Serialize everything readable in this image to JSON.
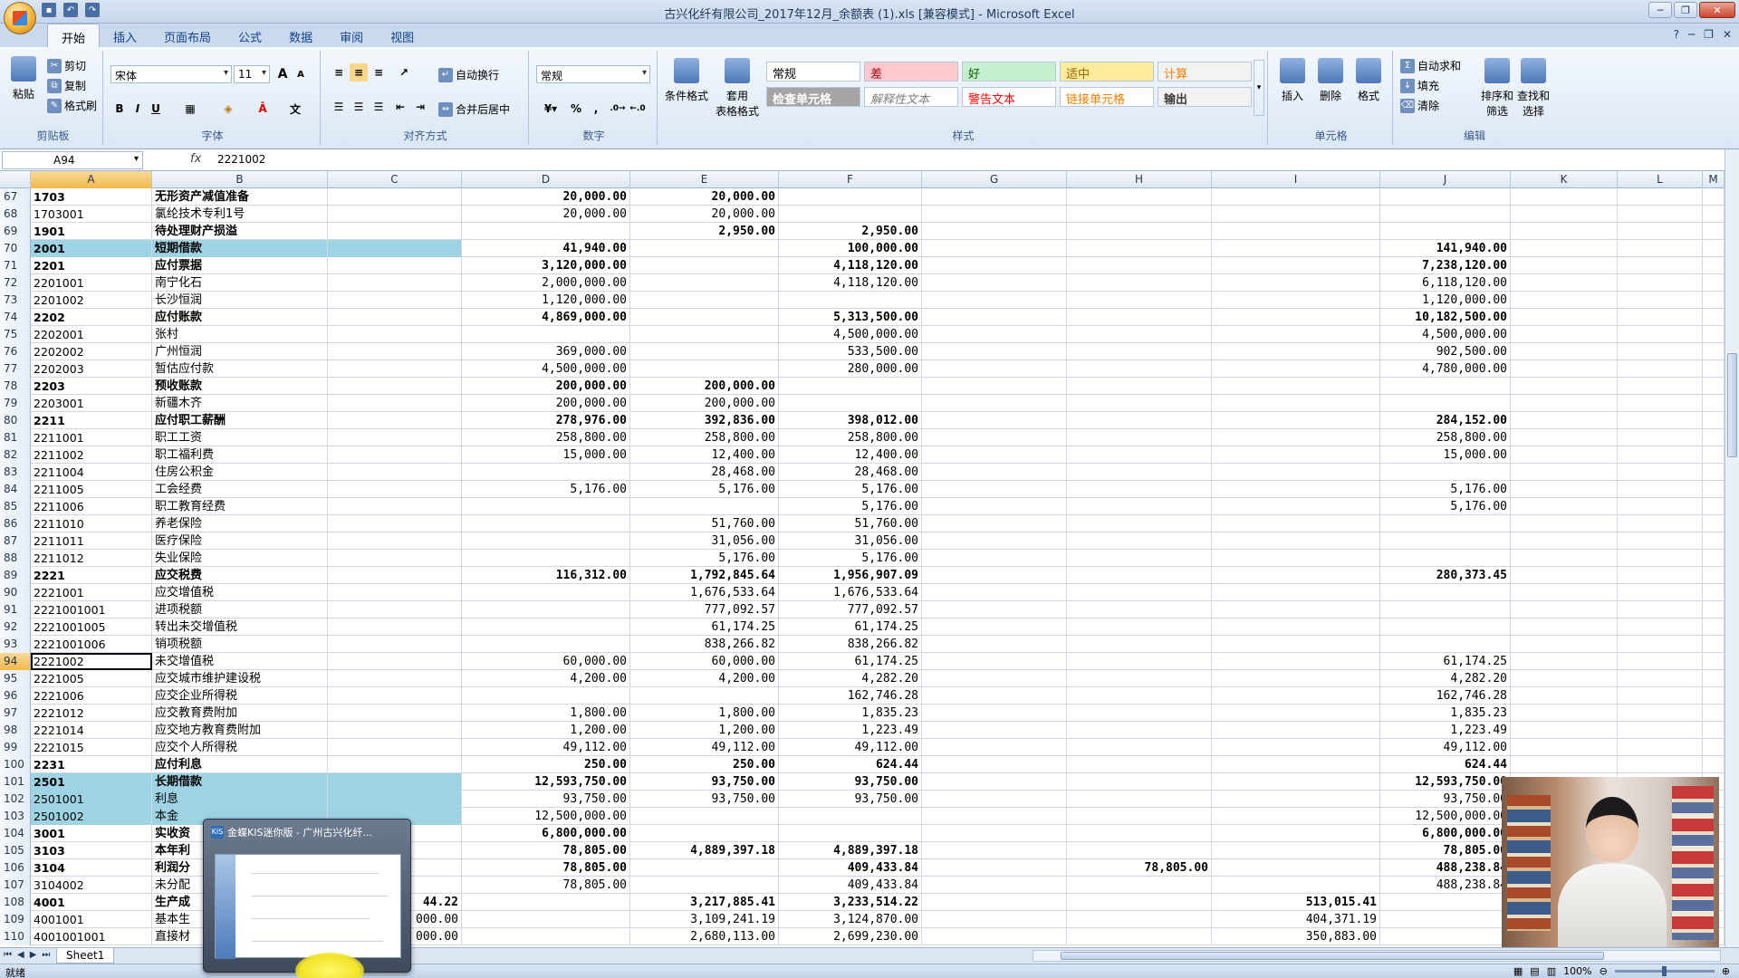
{
  "window": {
    "title": "古兴化纤有限公司_2017年12月_余额表 (1).xls  [兼容模式] - Microsoft Excel",
    "controls": [
      "─",
      "❐",
      "✕"
    ],
    "app_controls": [
      "?",
      "─",
      "❐",
      "✕"
    ]
  },
  "tabs": [
    "开始",
    "插入",
    "页面布局",
    "公式",
    "数据",
    "审阅",
    "视图"
  ],
  "ribbon": {
    "clipboard": {
      "paste": "粘贴",
      "cut": "剪切",
      "copy": "复制",
      "format_painter": "格式刷",
      "label": "剪贴板"
    },
    "font": {
      "name": "宋体",
      "size": "11",
      "bold": "B",
      "italic": "I",
      "underline": "U",
      "grow": "A",
      "shrink": "A",
      "label": "字体"
    },
    "alignment": {
      "wrap": "自动换行",
      "merge": "合并后居中",
      "label": "对齐方式"
    },
    "number": {
      "format": "常规",
      "percent": "%",
      "comma": ",",
      "label": "数字"
    },
    "styles": {
      "conditional": "条件格式",
      "table_format": "套用\n表格格式",
      "cells": [
        {
          "text": "常规",
          "bg": "#ffffff",
          "color": "#000000"
        },
        {
          "text": "差",
          "bg": "#ffc7ce",
          "color": "#9c0006"
        },
        {
          "text": "好",
          "bg": "#c6efce",
          "color": "#006100"
        },
        {
          "text": "适中",
          "bg": "#ffeb9c",
          "color": "#9c6500"
        },
        {
          "text": "计算",
          "bg": "#f2f2f2",
          "color": "#fa7d00"
        },
        {
          "text": "检查单元格",
          "bg": "#a5a5a5",
          "color": "#ffffff"
        },
        {
          "text": "解释性文本",
          "bg": "#ffffff",
          "color": "#7f7f7f"
        },
        {
          "text": "警告文本",
          "bg": "#ffffff",
          "color": "#ff0000"
        },
        {
          "text": "链接单元格",
          "bg": "#ffffff",
          "color": "#fa7d00"
        },
        {
          "text": "输出",
          "bg": "#f2f2f2",
          "color": "#3f3f3f"
        }
      ],
      "label": "样式"
    },
    "cells_group": {
      "insert": "插入",
      "delete": "删除",
      "format": "格式",
      "label": "单元格"
    },
    "editing": {
      "autosum": "自动求和",
      "fill": "填充",
      "clear": "清除",
      "sort": "排序和\n筛选",
      "find": "查找和\n选择",
      "label": "编辑"
    }
  },
  "formula_bar": {
    "name_box": "A94",
    "fx": "fx",
    "value": "2221002"
  },
  "columns": [
    "A",
    "B",
    "C",
    "D",
    "E",
    "F",
    "G",
    "H",
    "I",
    "J",
    "K",
    "L",
    "M"
  ],
  "rows": [
    {
      "n": "67",
      "a": "1703",
      "b": "无形资产减值准备",
      "c": "",
      "d": "20,000.00",
      "e": "20,000.00",
      "f": "",
      "g": "",
      "h": "",
      "i": "",
      "j": "",
      "bold": true
    },
    {
      "n": "68",
      "a": "1703001",
      "b": "氯纶技术专利1号",
      "c": "",
      "d": "20,000.00",
      "e": "20,000.00",
      "f": "",
      "g": "",
      "h": "",
      "i": "",
      "j": ""
    },
    {
      "n": "69",
      "a": "1901",
      "b": "待处理财产损溢",
      "c": "",
      "d": "",
      "e": "2,950.00",
      "f": "2,950.00",
      "g": "",
      "h": "",
      "i": "",
      "j": "",
      "bold": true
    },
    {
      "n": "70",
      "a": "2001",
      "b": "短期借款",
      "c": "",
      "d": "41,940.00",
      "e": "",
      "f": "100,000.00",
      "g": "",
      "h": "",
      "i": "",
      "j": "141,940.00",
      "bold": true,
      "hl": true
    },
    {
      "n": "71",
      "a": "2201",
      "b": "应付票据",
      "c": "",
      "d": "3,120,000.00",
      "e": "",
      "f": "4,118,120.00",
      "g": "",
      "h": "",
      "i": "",
      "j": "7,238,120.00",
      "bold": true
    },
    {
      "n": "72",
      "a": "2201001",
      "b": "南宁化石",
      "c": "",
      "d": "2,000,000.00",
      "e": "",
      "f": "4,118,120.00",
      "g": "",
      "h": "",
      "i": "",
      "j": "6,118,120.00"
    },
    {
      "n": "73",
      "a": "2201002",
      "b": "长沙恒润",
      "c": "",
      "d": "1,120,000.00",
      "e": "",
      "f": "",
      "g": "",
      "h": "",
      "i": "",
      "j": "1,120,000.00"
    },
    {
      "n": "74",
      "a": "2202",
      "b": "应付账款",
      "c": "",
      "d": "4,869,000.00",
      "e": "",
      "f": "5,313,500.00",
      "g": "",
      "h": "",
      "i": "",
      "j": "10,182,500.00",
      "bold": true
    },
    {
      "n": "75",
      "a": "2202001",
      "b": "张村",
      "c": "",
      "d": "",
      "e": "",
      "f": "4,500,000.00",
      "g": "",
      "h": "",
      "i": "",
      "j": "4,500,000.00"
    },
    {
      "n": "76",
      "a": "2202002",
      "b": "广州恒润",
      "c": "",
      "d": "369,000.00",
      "e": "",
      "f": "533,500.00",
      "g": "",
      "h": "",
      "i": "",
      "j": "902,500.00"
    },
    {
      "n": "77",
      "a": "2202003",
      "b": "暂估应付款",
      "c": "",
      "d": "4,500,000.00",
      "e": "",
      "f": "280,000.00",
      "g": "",
      "h": "",
      "i": "",
      "j": "4,780,000.00"
    },
    {
      "n": "78",
      "a": "2203",
      "b": "预收账款",
      "c": "",
      "d": "200,000.00",
      "e": "200,000.00",
      "f": "",
      "g": "",
      "h": "",
      "i": "",
      "j": "",
      "bold": true
    },
    {
      "n": "79",
      "a": "2203001",
      "b": "新疆木齐",
      "c": "",
      "d": "200,000.00",
      "e": "200,000.00",
      "f": "",
      "g": "",
      "h": "",
      "i": "",
      "j": ""
    },
    {
      "n": "80",
      "a": "2211",
      "b": "应付职工薪酬",
      "c": "",
      "d": "278,976.00",
      "e": "392,836.00",
      "f": "398,012.00",
      "g": "",
      "h": "",
      "i": "",
      "j": "284,152.00",
      "bold": true
    },
    {
      "n": "81",
      "a": "2211001",
      "b": "职工工资",
      "c": "",
      "d": "258,800.00",
      "e": "258,800.00",
      "f": "258,800.00",
      "g": "",
      "h": "",
      "i": "",
      "j": "258,800.00"
    },
    {
      "n": "82",
      "a": "2211002",
      "b": "职工福利费",
      "c": "",
      "d": "15,000.00",
      "e": "12,400.00",
      "f": "12,400.00",
      "g": "",
      "h": "",
      "i": "",
      "j": "15,000.00"
    },
    {
      "n": "83",
      "a": "2211004",
      "b": "住房公积金",
      "c": "",
      "d": "",
      "e": "28,468.00",
      "f": "28,468.00",
      "g": "",
      "h": "",
      "i": "",
      "j": ""
    },
    {
      "n": "84",
      "a": "2211005",
      "b": "工会经费",
      "c": "",
      "d": "5,176.00",
      "e": "5,176.00",
      "f": "5,176.00",
      "g": "",
      "h": "",
      "i": "",
      "j": "5,176.00"
    },
    {
      "n": "85",
      "a": "2211006",
      "b": "职工教育经费",
      "c": "",
      "d": "",
      "e": "",
      "f": "5,176.00",
      "g": "",
      "h": "",
      "i": "",
      "j": "5,176.00"
    },
    {
      "n": "86",
      "a": "2211010",
      "b": "养老保险",
      "c": "",
      "d": "",
      "e": "51,760.00",
      "f": "51,760.00",
      "g": "",
      "h": "",
      "i": "",
      "j": ""
    },
    {
      "n": "87",
      "a": "2211011",
      "b": "医疗保险",
      "c": "",
      "d": "",
      "e": "31,056.00",
      "f": "31,056.00",
      "g": "",
      "h": "",
      "i": "",
      "j": ""
    },
    {
      "n": "88",
      "a": "2211012",
      "b": "失业保险",
      "c": "",
      "d": "",
      "e": "5,176.00",
      "f": "5,176.00",
      "g": "",
      "h": "",
      "i": "",
      "j": ""
    },
    {
      "n": "89",
      "a": "2221",
      "b": "应交税费",
      "c": "",
      "d": "116,312.00",
      "e": "1,792,845.64",
      "f": "1,956,907.09",
      "g": "",
      "h": "",
      "i": "",
      "j": "280,373.45",
      "bold": true
    },
    {
      "n": "90",
      "a": "2221001",
      "b": "应交增值税",
      "c": "",
      "d": "",
      "e": "1,676,533.64",
      "f": "1,676,533.64",
      "g": "",
      "h": "",
      "i": "",
      "j": ""
    },
    {
      "n": "91",
      "a": "2221001001",
      "b": "进项税额",
      "c": "",
      "d": "",
      "e": "777,092.57",
      "f": "777,092.57",
      "g": "",
      "h": "",
      "i": "",
      "j": ""
    },
    {
      "n": "92",
      "a": "2221001005",
      "b": "转出未交增值税",
      "c": "",
      "d": "",
      "e": "61,174.25",
      "f": "61,174.25",
      "g": "",
      "h": "",
      "i": "",
      "j": ""
    },
    {
      "n": "93",
      "a": "2221001006",
      "b": "销项税额",
      "c": "",
      "d": "",
      "e": "838,266.82",
      "f": "838,266.82",
      "g": "",
      "h": "",
      "i": "",
      "j": ""
    },
    {
      "n": "94",
      "a": "2221002",
      "b": "未交增值税",
      "c": "",
      "d": "60,000.00",
      "e": "60,000.00",
      "f": "61,174.25",
      "g": "",
      "h": "",
      "i": "",
      "j": "61,174.25",
      "active": true
    },
    {
      "n": "95",
      "a": "2221005",
      "b": "应交城市维护建设税",
      "c": "",
      "d": "4,200.00",
      "e": "4,200.00",
      "f": "4,282.20",
      "g": "",
      "h": "",
      "i": "",
      "j": "4,282.20"
    },
    {
      "n": "96",
      "a": "2221006",
      "b": "应交企业所得税",
      "c": "",
      "d": "",
      "e": "",
      "f": "162,746.28",
      "g": "",
      "h": "",
      "i": "",
      "j": "162,746.28"
    },
    {
      "n": "97",
      "a": "2221012",
      "b": "应交教育费附加",
      "c": "",
      "d": "1,800.00",
      "e": "1,800.00",
      "f": "1,835.23",
      "g": "",
      "h": "",
      "i": "",
      "j": "1,835.23"
    },
    {
      "n": "98",
      "a": "2221014",
      "b": "应交地方教育费附加",
      "c": "",
      "d": "1,200.00",
      "e": "1,200.00",
      "f": "1,223.49",
      "g": "",
      "h": "",
      "i": "",
      "j": "1,223.49"
    },
    {
      "n": "99",
      "a": "2221015",
      "b": "应交个人所得税",
      "c": "",
      "d": "49,112.00",
      "e": "49,112.00",
      "f": "49,112.00",
      "g": "",
      "h": "",
      "i": "",
      "j": "49,112.00"
    },
    {
      "n": "100",
      "a": "2231",
      "b": "应付利息",
      "c": "",
      "d": "250.00",
      "e": "250.00",
      "f": "624.44",
      "g": "",
      "h": "",
      "i": "",
      "j": "624.44",
      "bold": true
    },
    {
      "n": "101",
      "a": "2501",
      "b": "长期借款",
      "c": "",
      "d": "12,593,750.00",
      "e": "93,750.00",
      "f": "93,750.00",
      "g": "",
      "h": "",
      "i": "",
      "j": "12,593,750.00",
      "bold": true,
      "hl": true
    },
    {
      "n": "102",
      "a": "2501001",
      "b": "利息",
      "c": "",
      "d": "93,750.00",
      "e": "93,750.00",
      "f": "93,750.00",
      "g": "",
      "h": "",
      "i": "",
      "j": "93,750.00",
      "hl": true
    },
    {
      "n": "103",
      "a": "2501002",
      "b": "本金",
      "c": "",
      "d": "12,500,000.00",
      "e": "",
      "f": "",
      "g": "",
      "h": "",
      "i": "",
      "j": "12,500,000.00",
      "hl": true
    },
    {
      "n": "104",
      "a": "3001",
      "b": "实收资",
      "c": "",
      "d": "6,800,000.00",
      "e": "",
      "f": "",
      "g": "",
      "h": "",
      "i": "",
      "j": "6,800,000.00",
      "bold": true
    },
    {
      "n": "105",
      "a": "3103",
      "b": "本年利",
      "c": "",
      "d": "78,805.00",
      "e": "4,889,397.18",
      "f": "4,889,397.18",
      "g": "",
      "h": "",
      "i": "",
      "j": "78,805.00",
      "bold": true
    },
    {
      "n": "106",
      "a": "3104",
      "b": "利润分",
      "c": "",
      "d": "78,805.00",
      "e": "",
      "f": "409,433.84",
      "g": "",
      "h": "78,805.00",
      "i": "",
      "j": "488,238.84",
      "bold": true
    },
    {
      "n": "107",
      "a": "3104002",
      "b": "未分配",
      "c": "",
      "d": "78,805.00",
      "e": "",
      "f": "409,433.84",
      "g": "",
      "h": "",
      "i": "",
      "j": "488,238.84"
    },
    {
      "n": "108",
      "a": "4001",
      "b": "生产成",
      "c": "44.22",
      "d": "",
      "e": "3,217,885.41",
      "f": "3,233,514.22",
      "g": "",
      "h": "",
      "i": "513,015.41",
      "j": "",
      "bold": true
    },
    {
      "n": "109",
      "a": "4001001",
      "b": "基本生",
      "c": "000.00",
      "d": "",
      "e": "3,109,241.19",
      "f": "3,124,870.00",
      "g": "",
      "h": "",
      "i": "404,371.19",
      "j": ""
    },
    {
      "n": "110",
      "a": "4001001001",
      "b": "直接材",
      "c": "000.00",
      "d": "",
      "e": "2,680,113.00",
      "f": "2,699,230.00",
      "g": "",
      "h": "",
      "i": "350,883.00",
      "j": ""
    }
  ],
  "sheet_tab": "Sheet1",
  "status": {
    "left": "就绪",
    "zoom": "100%"
  },
  "popup": {
    "title": "金蝶KIS迷你版 - 广州古兴化纤..."
  }
}
